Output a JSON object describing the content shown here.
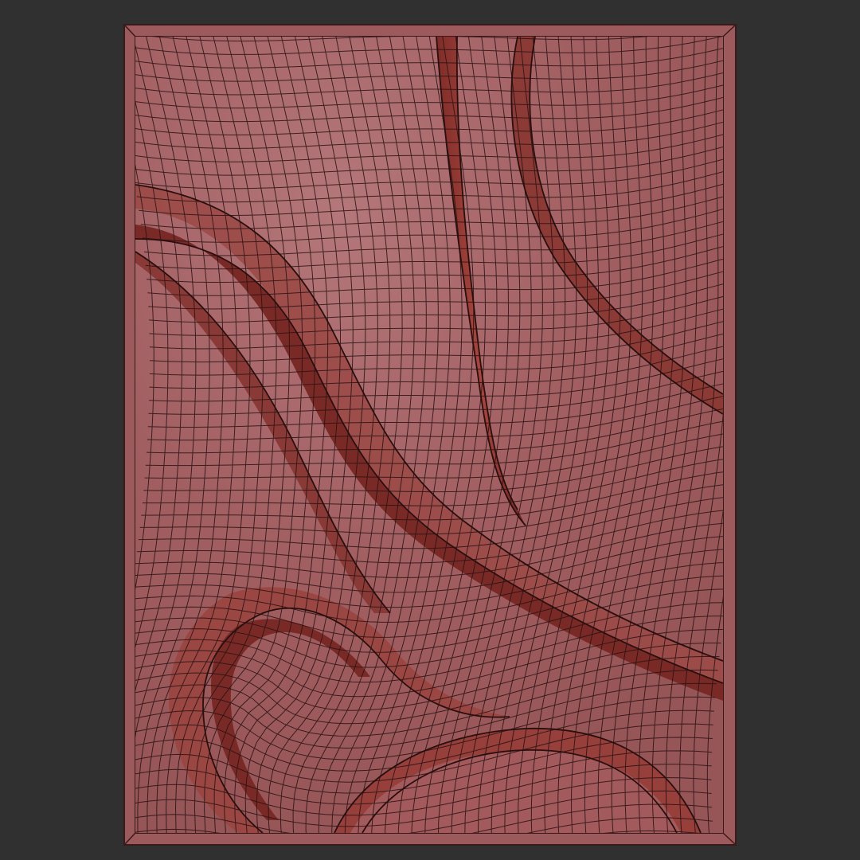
{
  "scene": {
    "background_color": "#303030",
    "panel_color": "#a35f62",
    "panel_highlight_color": "#b26f71",
    "groove_color": "#8e3a36",
    "groove_dark_color": "#6a2420",
    "wire_color": "#2a1212",
    "frame_color": "#9c5a5c",
    "frame_edge_color": "#3a1a1a"
  }
}
